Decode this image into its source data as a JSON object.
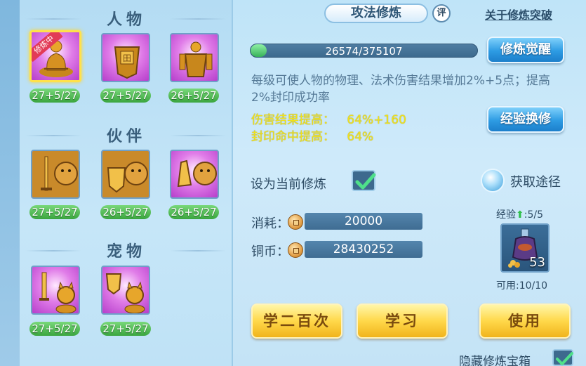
{
  "tab_title": "攻法修炼",
  "rate_badge": "评",
  "breakthrough_link": "关于修炼突破",
  "sections": {
    "character": "人物",
    "partner": "伙伴",
    "pet": "宠物"
  },
  "character_skills": [
    {
      "level": "27+5/27",
      "selected": true,
      "ribbon": "修炼中",
      "icon": "monk-meditate-icon"
    },
    {
      "level": "27+5/27",
      "selected": false,
      "icon": "armor-shield-icon"
    },
    {
      "level": "26+5/27",
      "selected": false,
      "icon": "warrior-armor-icon"
    }
  ],
  "partner_skills": [
    {
      "level": "27+5/27",
      "icon": "lion-sword-icon"
    },
    {
      "level": "26+5/27",
      "icon": "lion-shield-icon"
    },
    {
      "level": "26+5/27",
      "icon": "lion-fist-icon"
    }
  ],
  "pet_skills": [
    {
      "level": "27+5/27",
      "icon": "cat-sword-icon"
    },
    {
      "level": "27+5/27",
      "icon": "cat-shield-icon"
    }
  ],
  "progress": {
    "text": "26574/375107",
    "fraction": 0.0708
  },
  "buttons": {
    "awaken": "修炼觉醒",
    "exchange": "经验换修",
    "learn_200": "学二百次",
    "learn": "学习",
    "use": "使用"
  },
  "description": "每级可使人物的物理、法术伤害结果增加2%+5点；提高2%封印成功率",
  "bonuses": [
    {
      "label": "伤害结果提高：",
      "value": "64%+160"
    },
    {
      "label": "封印命中提高：",
      "value": "64%"
    }
  ],
  "set_current_label": "设为当前修炼",
  "set_current_checked": true,
  "get_way_label": "获取途径",
  "cost": {
    "label": "消耗：",
    "value": "20000"
  },
  "copper": {
    "label": "铜币：",
    "value": "28430252"
  },
  "exp_label": "经验",
  "exp_value": ":5/5",
  "item_count": "53",
  "available_label": "可用:10/10",
  "hide_chest_label": "隐藏修炼宝箱",
  "hide_chest_checked": true,
  "colors": {
    "accent_blue": "#2d9be3",
    "gold": "#ffd84a",
    "level_green": "#3aa53e",
    "bonus_yellow": "#f0e21b"
  }
}
